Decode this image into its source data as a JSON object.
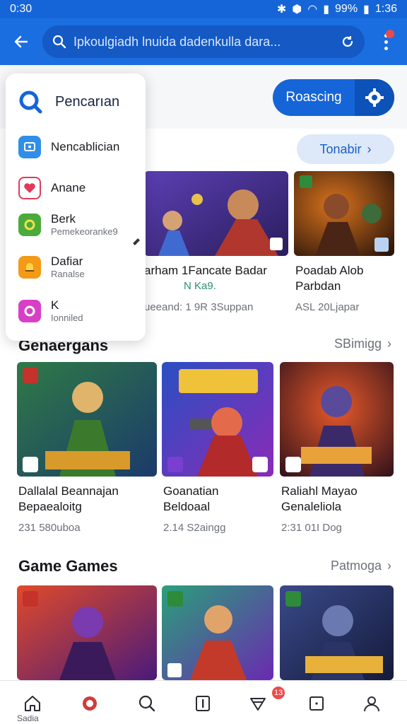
{
  "status_bar": {
    "time": "0:30",
    "battery": "99%",
    "clock_right": "1:36"
  },
  "app_bar": {
    "search_text": "Ipkoulgiadh lnuida dadenkulla dara..."
  },
  "category_button": {
    "label": "Roascing"
  },
  "menu": {
    "header": "Pencarıan",
    "items": [
      {
        "label": "Nencablician",
        "sub": "",
        "icon": "screen-icon",
        "color": "#2f8ee8"
      },
      {
        "label": "Anane",
        "sub": "",
        "icon": "heart-icon",
        "color": "#e23a5a"
      },
      {
        "label": "Berk",
        "sub": "Pemekeoranke9",
        "icon": "refresh-icon",
        "color": "#4aab3c"
      },
      {
        "label": "Dafiar",
        "sub": "Ranalse",
        "icon": "bell-icon",
        "color": "#f39a16"
      },
      {
        "label": "K",
        "sub": "Ionniled",
        "icon": "chat-icon",
        "color": "#d73fc7"
      }
    ]
  },
  "section1": {
    "more_label": "Tonabir",
    "cards": [
      {
        "title": "arham 1Fancate Badar",
        "rating": "N Ka9.",
        "meta": "ueeand: 1 9R 3Suppan"
      },
      {
        "title": "Poadab Alob\nParbdan",
        "rating": "",
        "meta": "ASL 20Ljapar"
      }
    ]
  },
  "section2": {
    "title": "Genaergans",
    "more_label": "SBimigg",
    "cards": [
      {
        "title": "Dallalal Beannajan\nBepaealoitg",
        "meta": "231 580uboa"
      },
      {
        "title": "Goanatian\nBeldoaal",
        "meta": "2.14 S2aingg"
      },
      {
        "title": "Raliahl Mayao\nGenaleliola",
        "meta": "2:31 01I Dog"
      }
    ]
  },
  "section3": {
    "title": "Game Games",
    "more_label": "Patmoga"
  },
  "bottom_nav": {
    "home_label": "Sadia",
    "badge_count": "13"
  },
  "colors": {
    "primary": "#1a6ee0",
    "primary_dark": "#1459c4",
    "badge": "#e94b4b"
  }
}
